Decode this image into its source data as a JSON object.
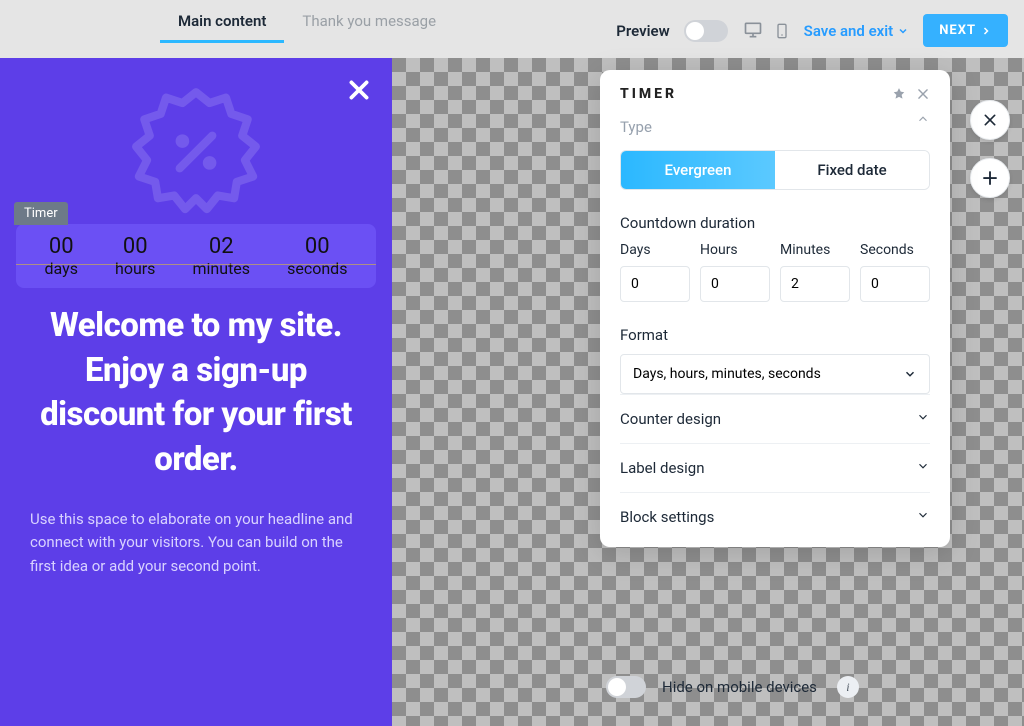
{
  "tabs": {
    "main": "Main content",
    "thanks": "Thank you message"
  },
  "top": {
    "preview": "Preview",
    "save_exit": "Save and exit",
    "next": "NEXT"
  },
  "popup": {
    "timer_tag": "Timer",
    "cells": [
      {
        "val": "00",
        "lbl": "days"
      },
      {
        "val": "00",
        "lbl": "hours"
      },
      {
        "val": "02",
        "lbl": "minutes"
      },
      {
        "val": "00",
        "lbl": "seconds"
      }
    ],
    "headline": "Welcome to my site. Enjoy a sign-up discount for your first order.",
    "body": "Use this space to elaborate on your headline and connect with your visitors. You can build on the first idea or add your second point."
  },
  "panel": {
    "title": "TIMER",
    "type_label": "Type",
    "seg_evergreen": "Evergreen",
    "seg_fixed": "Fixed date",
    "countdown_label": "Countdown duration",
    "cols": {
      "days_label": "Days",
      "days_val": "0",
      "hours_label": "Hours",
      "hours_val": "0",
      "minutes_label": "Minutes",
      "minutes_val": "2",
      "seconds_label": "Seconds",
      "seconds_val": "0"
    },
    "format_label": "Format",
    "format_value": "Days, hours, minutes, seconds",
    "acc_counter": "Counter design",
    "acc_label": "Label design",
    "acc_block": "Block settings",
    "hide_mobile": "Hide on mobile devices"
  }
}
